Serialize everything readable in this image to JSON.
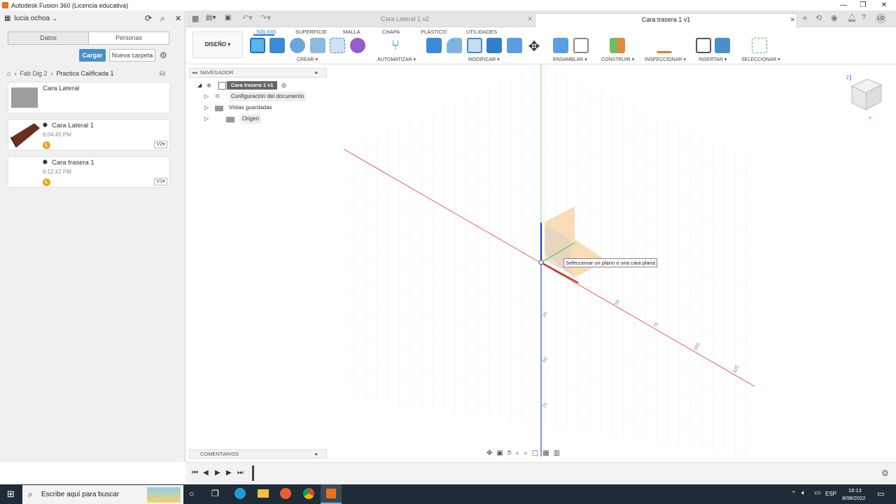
{
  "window": {
    "title": "Autodesk Fusion 360 (Licencia educativa)"
  },
  "user": {
    "name": "lucia ochoa",
    "initials": "LO"
  },
  "data_panel": {
    "tabs": [
      "Datos",
      "Personas"
    ],
    "upload_label": "Cargar",
    "new_folder_label": "Nueva carpeta",
    "breadcrumb": [
      "Fab Dig 2",
      "Practica Calificada 1"
    ],
    "items": [
      {
        "name": "Cara Lateral",
        "type": "folder",
        "time": "",
        "version": ""
      },
      {
        "name": "Cara Lateral 1",
        "type": "design",
        "time": "6:04:45 PM",
        "version": "V2",
        "badge": "L"
      },
      {
        "name": "Cara trasera 1",
        "type": "design",
        "time": "6:12:42 PM",
        "version": "V1",
        "badge": "L"
      }
    ]
  },
  "doc_tabs": [
    {
      "label": "Cara Lateral 1 v2",
      "active": false
    },
    {
      "label": "Cara trasera 1 v1",
      "active": true
    }
  ],
  "ribbon": {
    "workspace": "DISEÑO",
    "tabs": [
      "SÓLIDO",
      "SUPERFICIE",
      "MALLA",
      "CHAPA",
      "PLÁSTICO",
      "UTILIDADES"
    ],
    "active_tab": "SÓLIDO",
    "groups": [
      "CREAR",
      "AUTOMATIZAR",
      "MODIFICAR",
      "ENSAMBLAR",
      "CONSTRUIR",
      "INSPECCIONAR",
      "INSERTAR",
      "SELECCIONAR"
    ]
  },
  "navigator": {
    "title": "NAVEGADOR",
    "root": "Cara trasera 1 v1",
    "children": [
      "Configuración del documento",
      "Vistas guardadas",
      "Origen"
    ]
  },
  "comments": {
    "title": "COMENTARIOS"
  },
  "viewport": {
    "tooltip": "Seleccionar un plano o una cara plana",
    "grid_labels_x": [
      "50",
      "75",
      "100",
      "125"
    ],
    "grid_labels_y": [
      "25",
      "50",
      "75"
    ]
  },
  "taskbar": {
    "search_placeholder": "Escribe aquí para buscar",
    "language": "ESP",
    "time": "18:13",
    "date": "8/08/2022"
  },
  "colors": {
    "accent": "#1a73c8",
    "upload_button": "#4a90c8",
    "plane": "#f8d7a8",
    "x_axis": "#e05050",
    "y_axis": "#60c060",
    "z_axis": "#3050d0"
  }
}
